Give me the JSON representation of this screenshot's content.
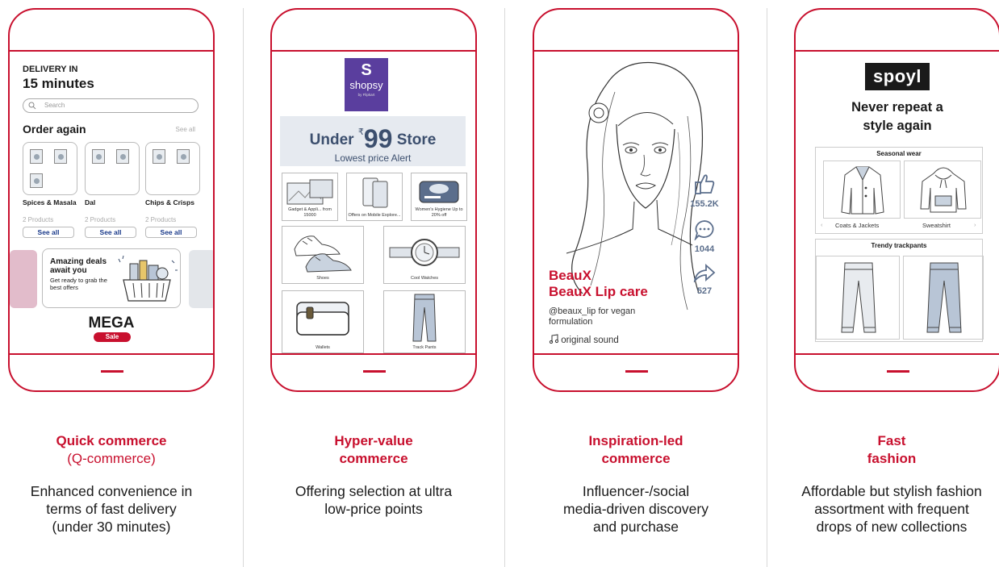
{
  "panels": [
    {
      "title": "Quick commerce",
      "subtitle": "(Q-commerce)",
      "description": "Enhanced convenience in terms of fast delivery (under 30 minutes)"
    },
    {
      "title": "Hyper-value commerce",
      "subtitle": "",
      "description": "Offering selection at ultra low-price points"
    },
    {
      "title": "Inspiration-led commerce",
      "subtitle": "",
      "description": "Influencer-/social media-driven discovery and purchase"
    },
    {
      "title": "Fast fashion",
      "subtitle": "",
      "description": "Affordable but stylish fashion assortment with frequent drops of new collections"
    }
  ],
  "qcommerce": {
    "delivery_label": "DELIVERY IN",
    "delivery_time": "15 minutes",
    "search_placeholder": "Search",
    "order_again": "Order again",
    "see_all_top": "See all",
    "categories": [
      {
        "name": "Spices & Masala",
        "count": "2 Products",
        "button": "See all"
      },
      {
        "name": "Dal",
        "count": "2 Products",
        "button": "See all"
      },
      {
        "name": "Chips & Crisps",
        "count": "2 Products",
        "button": "See all"
      }
    ],
    "promo_title": "Amazing deals await you",
    "promo_desc": "Get ready to grab the best offers",
    "mega": "MEGA",
    "sale": "Sale"
  },
  "shopsy": {
    "logo_letter": "S",
    "logo_name": "shopsy",
    "logo_by": "by Flipkart",
    "banner_under": "Under",
    "banner_rupee": "₹",
    "banner_price": "99",
    "banner_store": "Store",
    "banner_alert": "Lowest price Alert",
    "tiles": [
      {
        "label": "Gadget & Appli... from 15000"
      },
      {
        "label": "Offers on Mobile Explore..."
      },
      {
        "label": "Women's Hygiene Up to 20% off"
      },
      {
        "label": "Shoes"
      },
      {
        "label": "Cool Watches"
      },
      {
        "label": "Wallets"
      },
      {
        "label": "Track Pants"
      }
    ]
  },
  "beaux": {
    "brand": "BeauX",
    "product": "BeauX Lip care",
    "handle": "@beaux_lip for vegan formulation",
    "sound": "original sound",
    "likes": "155.2K",
    "comments": "1044",
    "shares": "527"
  },
  "spoyl": {
    "logo": "spoyl",
    "tagline_1": "Never repeat a",
    "tagline_2": "style again",
    "section_1": "Seasonal wear",
    "item_1": "Coats & Jackets",
    "item_2": "Sweatshirt",
    "section_2": "Trendy trackpants"
  },
  "colors": {
    "accent": "#c8102e",
    "shopsy_purple": "#5a3e9e",
    "icon_blue": "#5b6e8c"
  }
}
